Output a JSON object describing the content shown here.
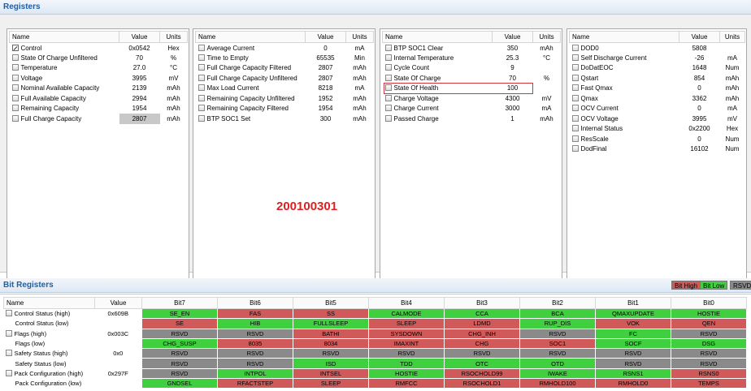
{
  "registers_header": "Registers",
  "columns": {
    "name": "Name",
    "value": "Value",
    "units": "Units"
  },
  "panels": [
    {
      "rows": [
        {
          "name": "Control",
          "value": "0x0542",
          "units": "Hex",
          "icon": "edit-icon"
        },
        {
          "name": "State Of Charge Unfiltered",
          "value": "70",
          "units": "%"
        },
        {
          "name": "Temperature",
          "value": "27.0",
          "units": "°C"
        },
        {
          "name": "Voltage",
          "value": "3995",
          "units": "mV"
        },
        {
          "name": "Nominal Available Capacity",
          "value": "2139",
          "units": "mAh"
        },
        {
          "name": "Full Available Capacity",
          "value": "2994",
          "units": "mAh"
        },
        {
          "name": "Remaining Capacity",
          "value": "1954",
          "units": "mAh"
        },
        {
          "name": "Full Charge Capacity",
          "value": "2807",
          "units": "mAh",
          "highlight": true
        }
      ]
    },
    {
      "rows": [
        {
          "name": "Average Current",
          "value": "0",
          "units": "mA"
        },
        {
          "name": "Time to Empty",
          "value": "65535",
          "units": "Min"
        },
        {
          "name": "Full Charge Capacity Filtered",
          "value": "2807",
          "units": "mAh"
        },
        {
          "name": "Full Charge Capacity Unfiltered",
          "value": "2807",
          "units": "mAh"
        },
        {
          "name": "Max Load Current",
          "value": "8218",
          "units": "mA"
        },
        {
          "name": "Remaining Capacity Unfiltered",
          "value": "1952",
          "units": "mAh"
        },
        {
          "name": "Remaining Capacity Filtered",
          "value": "1954",
          "units": "mAh"
        },
        {
          "name": "BTP SOC1 Set",
          "value": "300",
          "units": "mAh"
        }
      ]
    },
    {
      "rows": [
        {
          "name": "BTP SOC1 Clear",
          "value": "350",
          "units": "mAh"
        },
        {
          "name": "Internal Temperature",
          "value": "25.3",
          "units": "°C"
        },
        {
          "name": "Cycle Count",
          "value": "9",
          "units": ""
        },
        {
          "name": "State Of Charge",
          "value": "70",
          "units": "%"
        },
        {
          "name": "State Of Health",
          "value": "100",
          "units": "",
          "boxed": true
        },
        {
          "name": "Charge Voltage",
          "value": "4300",
          "units": "mV"
        },
        {
          "name": "Charge Current",
          "value": "3000",
          "units": "mA"
        },
        {
          "name": "Passed Charge",
          "value": "1",
          "units": "mAh"
        }
      ]
    },
    {
      "rows": [
        {
          "name": "DOD0",
          "value": "5808",
          "units": ""
        },
        {
          "name": "Self Discharge Current",
          "value": "-26",
          "units": "mA"
        },
        {
          "name": "DoDatEOC",
          "value": "1648",
          "units": "Num"
        },
        {
          "name": "Qstart",
          "value": "854",
          "units": "mAh"
        },
        {
          "name": "Fast Qmax",
          "value": "0",
          "units": "mAh"
        },
        {
          "name": "Qmax",
          "value": "3362",
          "units": "mAh"
        },
        {
          "name": "OCV Current",
          "value": "0",
          "units": "mA"
        },
        {
          "name": "OCV Voltage",
          "value": "3995",
          "units": "mV"
        },
        {
          "name": "Internal Status",
          "value": "0x2200",
          "units": "Hex"
        },
        {
          "name": "ResScale",
          "value": "0",
          "units": "Num"
        },
        {
          "name": "DodFinal",
          "value": "16102",
          "units": "Num"
        }
      ]
    }
  ],
  "overlay_number": "200100301",
  "bit_registers_header": "Bit Registers",
  "legend": [
    {
      "label": "Bit High",
      "color": "#d05a5a"
    },
    {
      "label": "Bit Low",
      "color": "#3fcf3f"
    },
    {
      "label": "RSVD",
      "color": "#8a8a8a"
    }
  ],
  "bit_columns": [
    "Name",
    "Value",
    "Bit7",
    "Bit6",
    "Bit5",
    "Bit4",
    "Bit3",
    "Bit2",
    "Bit1",
    "Bit0"
  ],
  "bit_rows": [
    {
      "name": "Control Status (high)",
      "value": "0x609B",
      "checkbox": true,
      "bits": [
        [
          "SE_EN",
          "low"
        ],
        [
          "FAS",
          "high"
        ],
        [
          "SS",
          "high"
        ],
        [
          "CALMODE",
          "low"
        ],
        [
          "CCA",
          "low"
        ],
        [
          "BCA",
          "low"
        ],
        [
          "QMAXUPDATE",
          "low"
        ],
        [
          "HOSTIE",
          "low"
        ]
      ]
    },
    {
      "name": "Control Status (low)",
      "value": "",
      "checkbox": false,
      "bits": [
        [
          "SE",
          "high"
        ],
        [
          "HIB",
          "low"
        ],
        [
          "FULLSLEEP",
          "low"
        ],
        [
          "SLEEP",
          "high"
        ],
        [
          "LDMD",
          "high"
        ],
        [
          "RUP_DIS",
          "low"
        ],
        [
          "VOK",
          "high"
        ],
        [
          "QEN",
          "high"
        ]
      ]
    },
    {
      "name": "Flags (high)",
      "value": "0x003C",
      "checkbox": true,
      "bits": [
        [
          "RSVD",
          "rsvd"
        ],
        [
          "RSVD",
          "rsvd"
        ],
        [
          "BATHI",
          "high"
        ],
        [
          "SYSDOWN",
          "high"
        ],
        [
          "CHG_INH",
          "high"
        ],
        [
          "RSVD",
          "rsvd"
        ],
        [
          "FC",
          "low"
        ],
        [
          "RSVD",
          "rsvd"
        ]
      ]
    },
    {
      "name": "Flags (low)",
      "value": "",
      "checkbox": false,
      "bits": [
        [
          "CHG_SUSP",
          "low"
        ],
        [
          "8035",
          "high"
        ],
        [
          "8034",
          "high"
        ],
        [
          "IMAXINT",
          "high"
        ],
        [
          "CHG",
          "high"
        ],
        [
          "SOC1",
          "high"
        ],
        [
          "SOCF",
          "low"
        ],
        [
          "DSG",
          "low"
        ]
      ]
    },
    {
      "name": "Safety Status (high)",
      "value": "0x0",
      "checkbox": true,
      "bits": [
        [
          "RSVD",
          "rsvd"
        ],
        [
          "RSVD",
          "rsvd"
        ],
        [
          "RSVD",
          "rsvd"
        ],
        [
          "RSVD",
          "rsvd"
        ],
        [
          "RSVD",
          "rsvd"
        ],
        [
          "RSVD",
          "rsvd"
        ],
        [
          "RSVD",
          "rsvd"
        ],
        [
          "RSVD",
          "rsvd"
        ]
      ]
    },
    {
      "name": "Safety Status (low)",
      "value": "",
      "checkbox": false,
      "bits": [
        [
          "RSVD",
          "rsvd"
        ],
        [
          "RSVD",
          "rsvd"
        ],
        [
          "ISD",
          "low"
        ],
        [
          "TDD",
          "low"
        ],
        [
          "OTC",
          "low"
        ],
        [
          "OTD",
          "low"
        ],
        [
          "RSVD",
          "rsvd"
        ],
        [
          "RSVD",
          "rsvd"
        ]
      ]
    },
    {
      "name": "Pack Configuration (high)",
      "value": "0x297F",
      "checkbox": true,
      "bits": [
        [
          "RSVD",
          "rsvd"
        ],
        [
          "INTPOL",
          "low"
        ],
        [
          "INTSEL",
          "high"
        ],
        [
          "HOSTIE",
          "low"
        ],
        [
          "RSOCHOLD99",
          "high"
        ],
        [
          "IWAKE",
          "low"
        ],
        [
          "RSNS1",
          "low"
        ],
        [
          "RSNS0",
          "high"
        ]
      ]
    },
    {
      "name": "Pack Configuration (low)",
      "value": "",
      "checkbox": false,
      "bits": [
        [
          "GNDSEL",
          "low"
        ],
        [
          "RFACTSTEP",
          "high"
        ],
        [
          "SLEEP",
          "high"
        ],
        [
          "RMFCC",
          "high"
        ],
        [
          "RSOCHOLD1",
          "high"
        ],
        [
          "RMHOLD100",
          "high"
        ],
        [
          "RMHOLD0",
          "high"
        ],
        [
          "TEMPS",
          "high"
        ]
      ]
    }
  ]
}
